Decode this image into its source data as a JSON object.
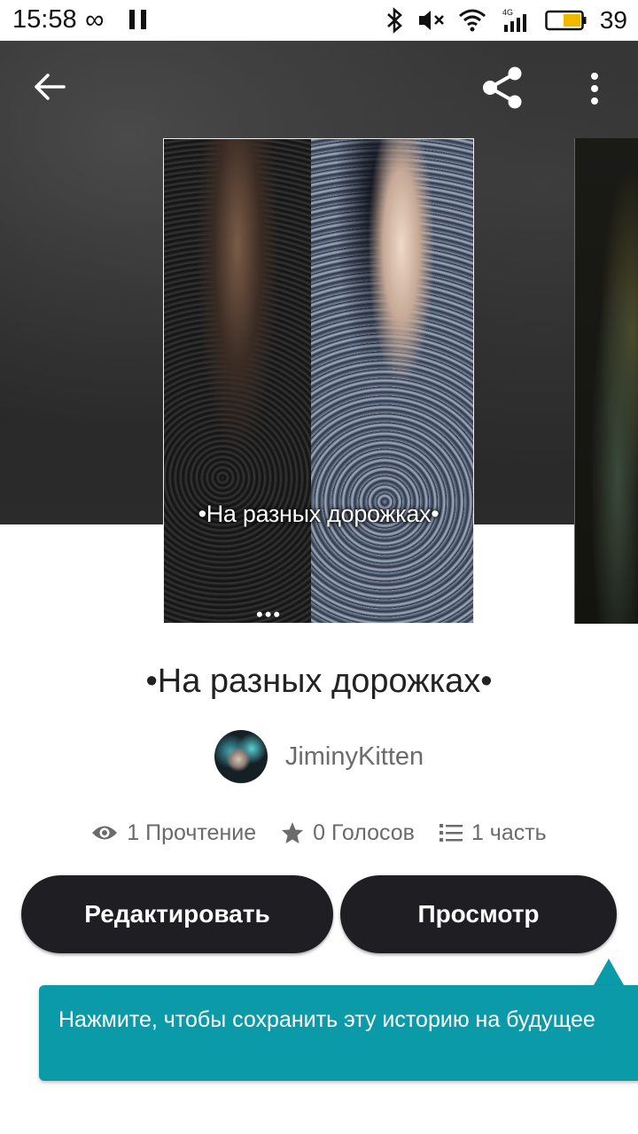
{
  "status_bar": {
    "time": "15:58",
    "battery_level": "39",
    "icons": [
      "infinity-icon",
      "pause-icon",
      "bluetooth-icon",
      "mute-icon",
      "wifi-icon",
      "signal-4g-icon",
      "battery-icon"
    ]
  },
  "header": {
    "back_icon": "arrow-left-icon",
    "share_icon": "share-icon",
    "more_icon": "more-vertical-icon"
  },
  "cover": {
    "overlay_title": "•На разных дорожках•",
    "overlay_dots": "•••"
  },
  "story": {
    "title": "•На разных дорожках•",
    "author": "JiminyKitten"
  },
  "stats": {
    "reads": "1 Прочтение",
    "votes": "0 Голосов",
    "parts": "1 часть"
  },
  "buttons": {
    "edit": "Редактировать",
    "view": "Просмотр"
  },
  "tooltip": {
    "text": "Нажмите, чтобы сохранить эту историю на будущее"
  },
  "colors": {
    "button_bg": "#1f1e22",
    "tooltip_bg": "#0b9aa8",
    "muted_text": "#6b6b6b"
  }
}
